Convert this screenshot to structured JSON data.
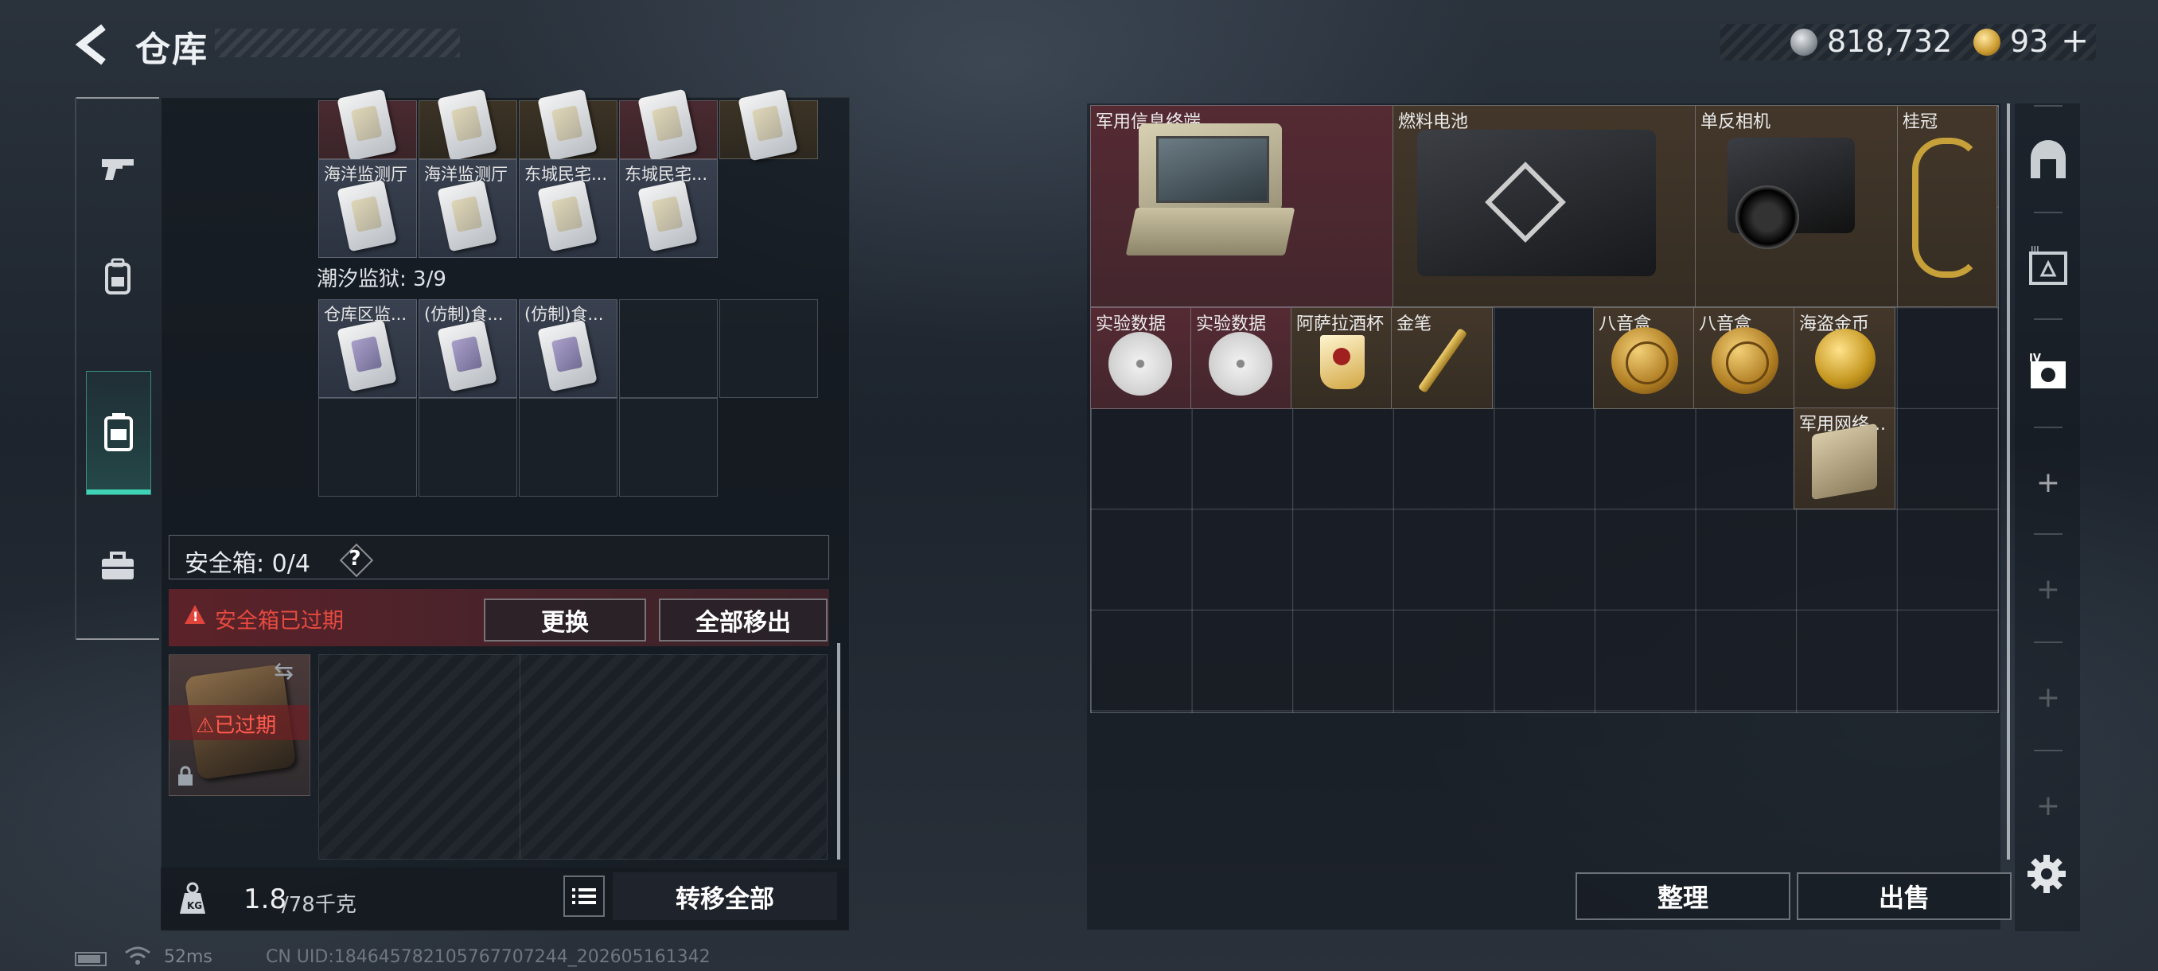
{
  "header": {
    "title": "仓库",
    "currency_silver": "818,732",
    "currency_gold": "93",
    "currency_plus": "+"
  },
  "left_panel": {
    "top_row_labels": [
      "海洋监测厅",
      "海洋监测厅",
      "东城民宅...",
      "东城民宅..."
    ],
    "prison_label": "潮汐监狱: 3/9",
    "prison_items": [
      "仓库区监...",
      "(仿制)食...",
      "(仿制)食..."
    ],
    "safebox": {
      "label": "安全箱: 0/4",
      "help": "?",
      "expired_warning": "安全箱已过期",
      "replace_button": "更换",
      "move_all_button": "全部移出",
      "case_status": "⚠已过期"
    },
    "footer": {
      "weight_current": "1.8",
      "weight_max": "/78千克",
      "transfer_all_button": "转移全部"
    }
  },
  "stash": {
    "items": [
      {
        "label": "军用信息终端"
      },
      {
        "label": "燃料电池"
      },
      {
        "label": "单反相机"
      },
      {
        "label": "桂冠"
      },
      {
        "label": "实验数据"
      },
      {
        "label": "实验数据"
      },
      {
        "label": "阿萨拉酒杯"
      },
      {
        "label": "金笔"
      },
      {
        "label": "八音盒"
      },
      {
        "label": "八音盒"
      },
      {
        "label": "海盗金币"
      },
      {
        "label": "军用网络..."
      }
    ],
    "sort_button": "整理",
    "sell_button": "出售"
  },
  "status_bar": {
    "ping": "52ms",
    "uid": "CN UID:184645782105767707244_202605161342"
  },
  "colors": {
    "accent": "#3fd3b5",
    "warning": "#e64a3f",
    "item_red": "#552a33",
    "item_gold": "#43372a"
  }
}
